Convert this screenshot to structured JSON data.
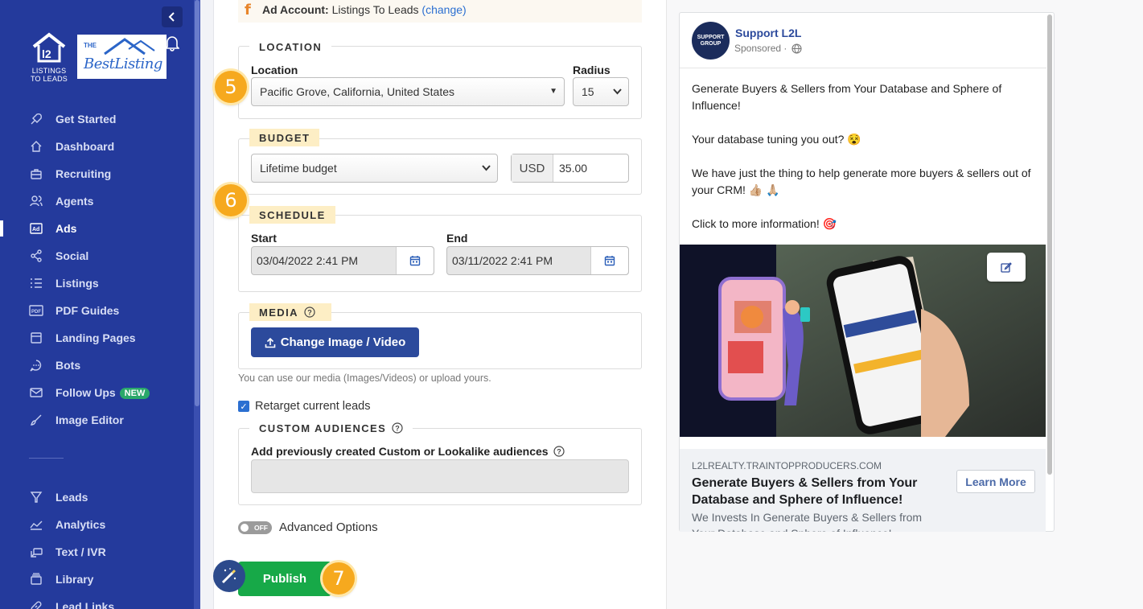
{
  "sidebar": {
    "logo_text_line1": "LISTINGS",
    "logo_text_line2": "TO LEADS",
    "brand_logo_the": "THE",
    "brand_logo_name": "BestListing",
    "items": [
      {
        "label": "Get Started",
        "icon": "rocket-icon"
      },
      {
        "label": "Dashboard",
        "icon": "home-icon"
      },
      {
        "label": "Recruiting",
        "icon": "briefcase-icon"
      },
      {
        "label": "Agents",
        "icon": "users-icon"
      },
      {
        "label": "Ads",
        "icon": "ad-icon",
        "active": true
      },
      {
        "label": "Social",
        "icon": "share-icon"
      },
      {
        "label": "Listings",
        "icon": "list-icon"
      },
      {
        "label": "PDF Guides",
        "icon": "pdf-icon"
      },
      {
        "label": "Landing Pages",
        "icon": "window-icon"
      },
      {
        "label": "Bots",
        "icon": "chat-icon"
      },
      {
        "label": "Follow Ups",
        "icon": "mail-icon",
        "badge": "NEW"
      },
      {
        "label": "Image Editor",
        "icon": "brush-icon"
      },
      {
        "label": "Leads",
        "icon": "filter-icon"
      },
      {
        "label": "Analytics",
        "icon": "chart-icon"
      },
      {
        "label": "Text / IVR",
        "icon": "phone-icon"
      },
      {
        "label": "Library",
        "icon": "library-icon"
      },
      {
        "label": "Lead Links",
        "icon": "link-icon"
      }
    ]
  },
  "ad_account": {
    "label": "Ad Account:",
    "value": "Listings To Leads",
    "change_link": "change"
  },
  "location": {
    "legend": "LOCATION",
    "location_label": "Location",
    "location_value": "Pacific Grove, California, United States",
    "radius_label": "Radius",
    "radius_value": "15"
  },
  "budget": {
    "legend": "BUDGET",
    "type_value": "Lifetime budget",
    "currency": "USD",
    "amount": "35.00"
  },
  "schedule": {
    "legend": "SCHEDULE",
    "start_label": "Start",
    "start_value": "03/04/2022 2:41 PM",
    "end_label": "End",
    "end_value": "03/11/2022 2:41 PM"
  },
  "media": {
    "legend": "MEDIA",
    "button": "Change Image / Video",
    "hint": "You can use our media (Images/Videos) or upload yours."
  },
  "retarget": {
    "label": "Retarget current leads",
    "checked": true
  },
  "audiences": {
    "legend": "CUSTOM AUDIENCES",
    "label": "Add previously created Custom or Lookalike audiences"
  },
  "advanced": {
    "toggle": "OFF",
    "label": "Advanced Options"
  },
  "publish": {
    "label": "Publish"
  },
  "steps": {
    "s5": "5",
    "s6": "6",
    "s7": "7"
  },
  "preview": {
    "avatar_line1": "SUPPORT",
    "avatar_line2": "GROUP",
    "page_name": "Support L2L",
    "sponsored": "Sponsored ·",
    "text_1": "Generate Buyers & Sellers from Your Database and Sphere of Influence!",
    "text_2": "Your database tuning you out? 😵",
    "text_3": "We have just the thing to help generate more buyers & sellers out of your CRM! 👍🏼 🙏🏼",
    "text_4": "Click to more information! 🎯",
    "domain": "L2LREALTY.TRAINTOPPRODUCERS.COM",
    "headline": "Generate Buyers & Sellers from Your Database and Sphere of Influence!",
    "description": "We Invests In Generate Buyers & Sellers from Your Database and Sphere of Influence!",
    "cta": "Learn More"
  },
  "colors": {
    "sidebar_bg": "#243a9c",
    "step_badge": "#f6a91e",
    "publish_green": "#17a948",
    "primary_blue": "#2c4a9c",
    "legend_highlight": "#fdeec5"
  }
}
